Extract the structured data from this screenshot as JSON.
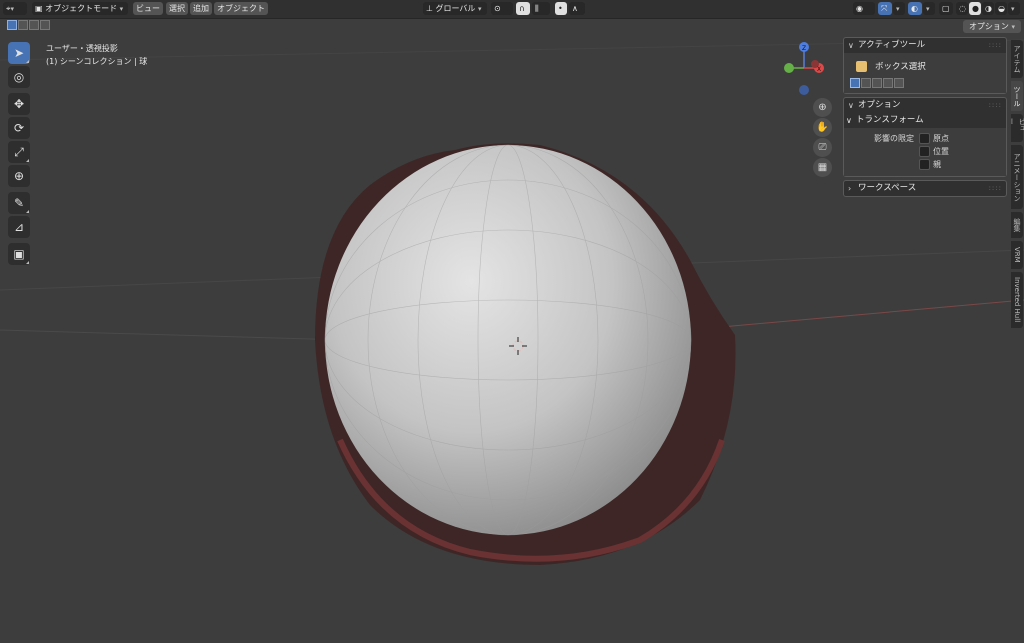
{
  "header": {
    "mode_label": "オブジェクトモード",
    "menus": [
      "ビュー",
      "選択",
      "追加",
      "オブジェクト"
    ],
    "transform_orientation": "グローバル",
    "options_button": "オプション"
  },
  "viewport_info": {
    "view_name": "ユーザー・透視投影",
    "collection": "(1) シーンコレクション | 球"
  },
  "gizmo": {
    "z": "Z",
    "x": "X"
  },
  "sidebar": {
    "active_tool": {
      "title": "アクティブツール",
      "tool_name": "ボックス選択"
    },
    "options": {
      "title": "オプション",
      "transform": {
        "title": "トランスフォーム",
        "affect_only_label": "影響の限定",
        "checkboxes": [
          "原点",
          "位置",
          "親"
        ]
      }
    },
    "workspace": {
      "title": "ワークスペース"
    }
  },
  "tabs": [
    "アイテム",
    "ツール",
    "ビュー",
    "アニメーション",
    "編集",
    "VRM",
    "Inverted Hull"
  ],
  "colors": {
    "accent": "#4772b3",
    "background": "#3d3d3d",
    "hull": "#4a2b2b",
    "sphere": "#c8c8c8"
  }
}
